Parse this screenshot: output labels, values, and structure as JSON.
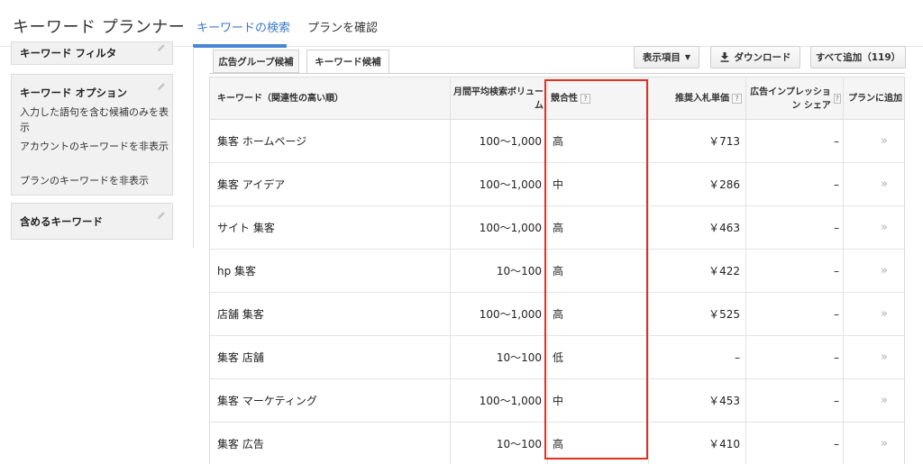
{
  "header": {
    "app_title": "キーワード プランナー",
    "tabs": [
      {
        "label": "キーワードの検索",
        "active": true
      },
      {
        "label": "プランを確認",
        "active": false
      }
    ]
  },
  "sidebar": {
    "filter_title": "キーワード フィルタ",
    "options_title": "キーワード オプション",
    "options": [
      "入力した語句を含む候補のみを表示",
      "アカウントのキーワードを非表示",
      "プランのキーワードを非表示"
    ],
    "include_title": "含めるキーワード"
  },
  "subtabs": [
    {
      "label": "広告グループ候補",
      "active": false
    },
    {
      "label": "キーワード候補",
      "active": true
    }
  ],
  "toolbar": {
    "columns_label": "表示項目",
    "download_label": "ダウンロード",
    "add_all_label": "すべて追加（119）"
  },
  "table": {
    "headers": {
      "keyword": "キーワード（関連性の高い順）",
      "volume": "月間平均検索ボリューム",
      "competition": "競合性",
      "bid": "推奨入札単価",
      "impression_share": "広告インプレッション シェア",
      "add": "プランに追加"
    },
    "rows": [
      {
        "keyword": "集客 ホームページ",
        "volume": "100〜1,000",
        "competition": "高",
        "bid": "￥713",
        "share": "–"
      },
      {
        "keyword": "集客 アイデア",
        "volume": "100〜1,000",
        "competition": "中",
        "bid": "￥286",
        "share": "–"
      },
      {
        "keyword": "サイト 集客",
        "volume": "100〜1,000",
        "competition": "高",
        "bid": "￥463",
        "share": "–"
      },
      {
        "keyword": "hp 集客",
        "volume": "10〜100",
        "competition": "高",
        "bid": "￥422",
        "share": "–"
      },
      {
        "keyword": "店舗 集客",
        "volume": "100〜1,000",
        "competition": "高",
        "bid": "￥525",
        "share": "–"
      },
      {
        "keyword": "集客 店舗",
        "volume": "10〜100",
        "competition": "低",
        "bid": "–",
        "share": "–"
      },
      {
        "keyword": "集客 マーケティング",
        "volume": "100〜1,000",
        "competition": "中",
        "bid": "￥453",
        "share": "–"
      },
      {
        "keyword": "集客 広告",
        "volume": "10〜100",
        "competition": "高",
        "bid": "￥410",
        "share": "–"
      }
    ]
  },
  "colors": {
    "accent": "#4a86d6",
    "highlight": "#e03020"
  }
}
